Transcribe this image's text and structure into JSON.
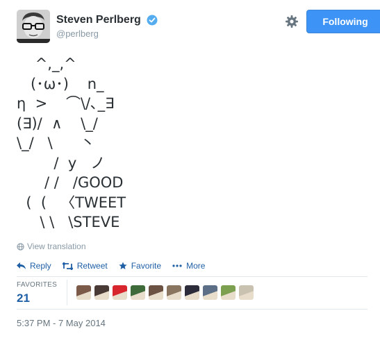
{
  "author": {
    "name": "Steven Perlberg",
    "handle": "@perlberg",
    "verified": true
  },
  "follow_button": {
    "label": "Following"
  },
  "tweet": {
    "text": "    ^,_,^\n   (･ω･)    n_\nη  >    ⌒\\/､_∃\n(∃)/  ∧    \\_/\n\\_/   \\      丶\n        /  y   ノ\n      / /   /GOOD\n  (  (   〈TWEET\n     \\ \\   \\STEVE"
  },
  "translation": {
    "label": "View translation"
  },
  "actions": {
    "reply": "Reply",
    "retweet": "Retweet",
    "favorite": "Favorite",
    "more": "More"
  },
  "favorites": {
    "label": "FAVORITES",
    "count": "21",
    "avatars": [
      "#7b5a4a",
      "#4a3a36",
      "#d8262e",
      "#3f6b3a",
      "#6c5243",
      "#8a7560",
      "#2c2c3a",
      "#5d6f86",
      "#7da050",
      "#c9c2b0"
    ]
  },
  "timestamp": "5:37 PM - 7 May 2014",
  "colors": {
    "link": "#1f5fa6",
    "follow_bg": "#3d94f6",
    "verified": "#55acee"
  }
}
